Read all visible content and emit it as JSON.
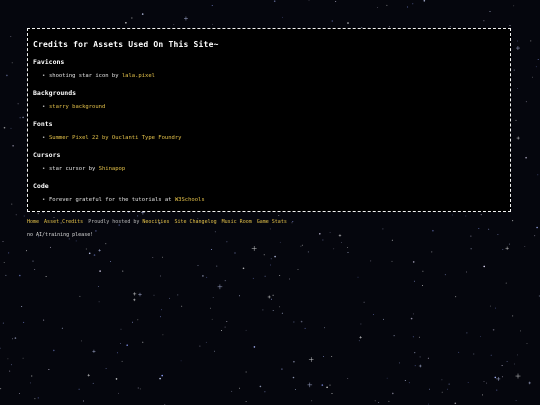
{
  "title": "Credits for Assets Used On This Site~",
  "sections": [
    {
      "heading": "Favicons",
      "items": [
        {
          "text": "shooting star icon by ",
          "link": "lala.pixel"
        }
      ]
    },
    {
      "heading": "Backgrounds",
      "items": [
        {
          "text": "",
          "link": "starry background"
        }
      ]
    },
    {
      "heading": "Fonts",
      "items": [
        {
          "text": "",
          "link": "Summer Pixel 22 by Ouclanti Type Foundry"
        }
      ]
    },
    {
      "heading": "Cursors",
      "items": [
        {
          "text": "star cursor by ",
          "link": "Shinapop"
        }
      ]
    },
    {
      "heading": "Code",
      "items": [
        {
          "text": "Forever grateful for the tutorials at ",
          "link": "W3Schools"
        }
      ]
    }
  ],
  "footer": {
    "links_left": [
      "Home",
      "Asset Credits"
    ],
    "hosted_text": "Proudly hosted by ",
    "hosted_link": "Neocities",
    "links_right": [
      "Site Changelog",
      "Music Room",
      "Game Stats"
    ]
  },
  "notice": "no AI/training please!",
  "colors": {
    "background": "#05060d",
    "panel": "#000000",
    "border": "#f2f2f2",
    "link": "#e6c34a",
    "text": "#ffffff"
  }
}
